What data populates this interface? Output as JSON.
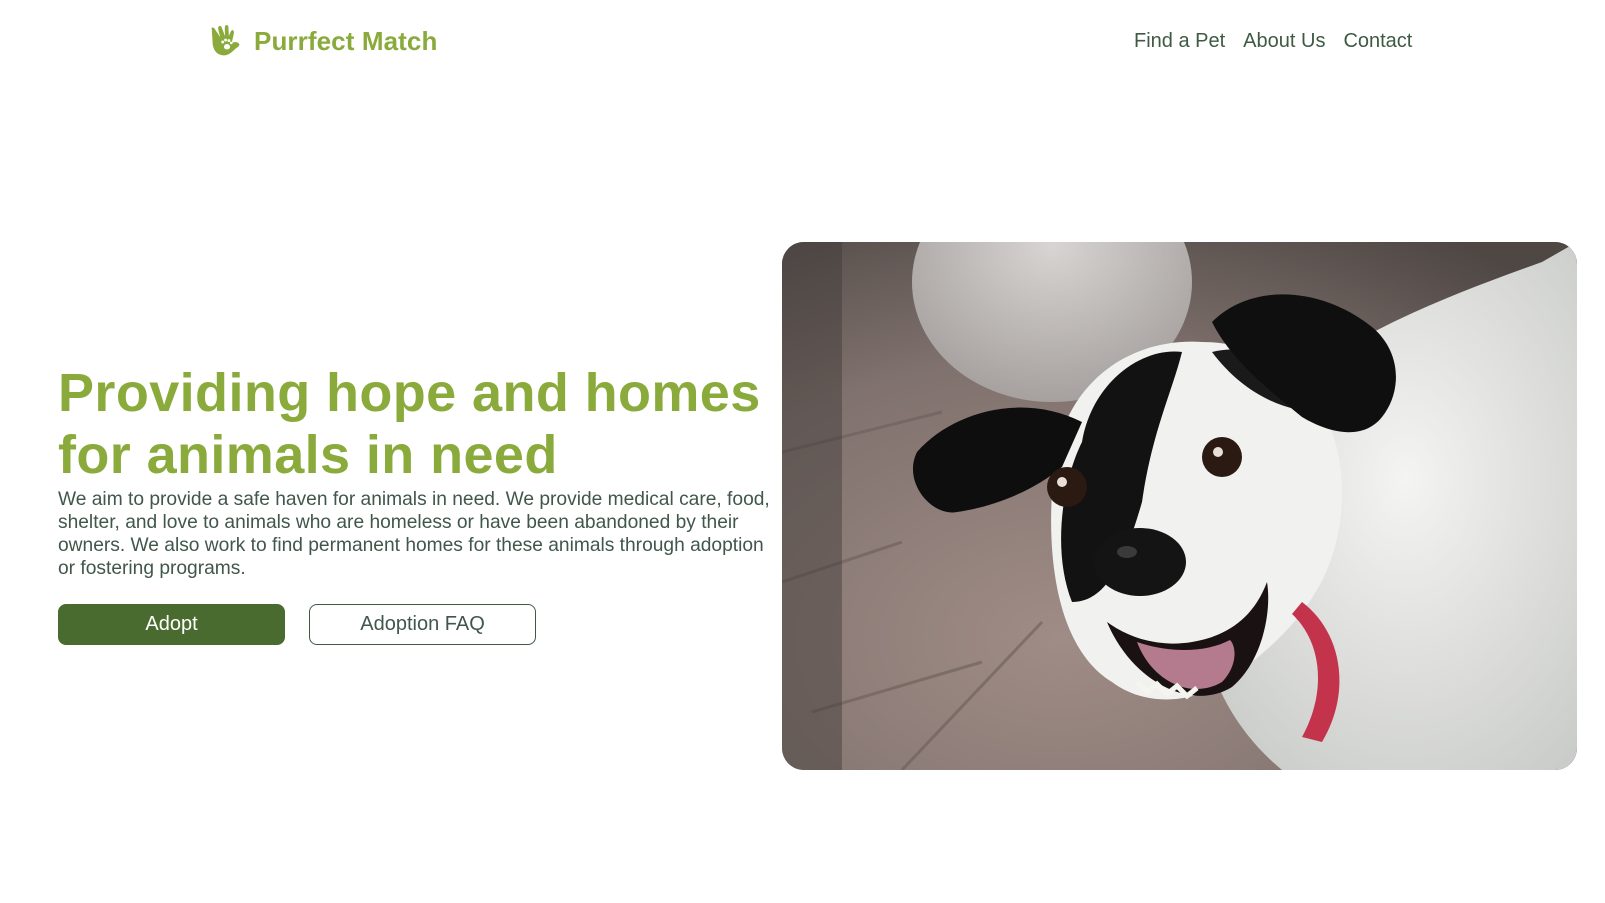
{
  "brand": {
    "name": "Purrfect Match",
    "logo_icon": "hand-paw-icon",
    "color": "#8aab3c"
  },
  "nav": {
    "items": [
      {
        "label": "Find a Pet"
      },
      {
        "label": "About Us"
      },
      {
        "label": "Contact"
      }
    ]
  },
  "hero": {
    "title": "Providing hope and homes for animals in need",
    "description": "We aim to provide a safe haven for animals in need. We provide medical care, food, shelter, and love to animals who are homeless or have been abandoned by their owners. We also work to find permanent homes for these animals through adoption or fostering programs.",
    "primary_button": "Adopt",
    "secondary_button": "Adoption FAQ",
    "image": "dog-photo"
  },
  "colors": {
    "accent": "#8aab3c",
    "primary_button": "#4a6b30",
    "text": "#41574b"
  }
}
